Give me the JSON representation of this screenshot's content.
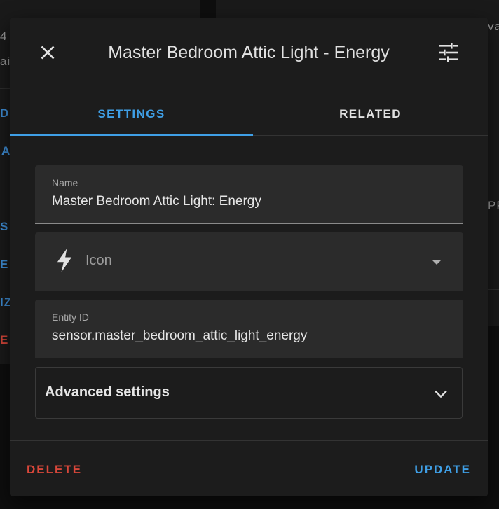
{
  "background": {
    "fragments": [
      {
        "text": "4",
        "tone": "grey"
      },
      {
        "text": "ai",
        "tone": "grey"
      },
      {
        "text": "DE",
        "tone": "blue"
      },
      {
        "text": "A",
        "tone": "blue"
      },
      {
        "text": "S",
        "tone": "blue"
      },
      {
        "text": "E",
        "tone": "blue"
      },
      {
        "text": "IZ",
        "tone": "blue"
      },
      {
        "text": "E",
        "tone": "red"
      },
      {
        "text": "va",
        "tone": "grey"
      },
      {
        "text": "PP",
        "tone": "grey"
      }
    ]
  },
  "dialog": {
    "title": "Master Bedroom Attic Light - Energy",
    "close_icon": "close-icon",
    "settings_icon": "tune-icon",
    "tabs": [
      {
        "label": "SETTINGS",
        "active": true
      },
      {
        "label": "RELATED",
        "active": false
      }
    ],
    "fields": {
      "name": {
        "label": "Name",
        "value": "Master Bedroom Attic Light: Energy"
      },
      "icon": {
        "placeholder": "Icon",
        "icon": "lightning-bolt-icon"
      },
      "entity_id": {
        "label": "Entity ID",
        "value": "sensor.master_bedroom_attic_light_energy"
      }
    },
    "advanced": {
      "label": "Advanced settings"
    },
    "actions": {
      "delete": "DELETE",
      "update": "UPDATE"
    }
  },
  "colors": {
    "accent": "#3f9fe6",
    "danger": "#d9473a",
    "surface": "#1c1c1c",
    "field": "#2b2b2b"
  }
}
